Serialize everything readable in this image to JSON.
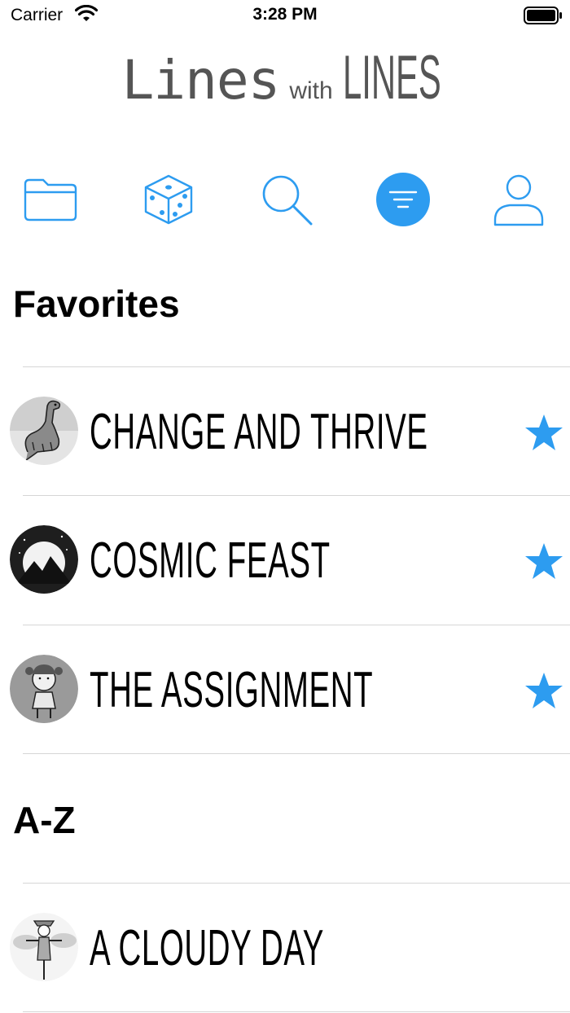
{
  "status": {
    "carrier": "Carrier",
    "time": "3:28 PM"
  },
  "app": {
    "title_part1": "Lines",
    "title_part2": "with",
    "title_part3": "LINES"
  },
  "toolbar": {
    "accent": "#2d9cf0",
    "selected": "filter"
  },
  "favorites": {
    "header": "Favorites",
    "items": [
      {
        "title": "Change And Thrive",
        "favorited": true,
        "thumb": "dinosaur-illustration"
      },
      {
        "title": "Cosmic Feast",
        "favorited": true,
        "thumb": "mountain-moon-illustration"
      },
      {
        "title": "The Assignment",
        "favorited": true,
        "thumb": "girl-illustration"
      }
    ]
  },
  "az": {
    "header": "A-Z",
    "items": [
      {
        "title": "A Cloudy Day",
        "favorited": false,
        "thumb": "scarecrow-illustration"
      }
    ]
  }
}
